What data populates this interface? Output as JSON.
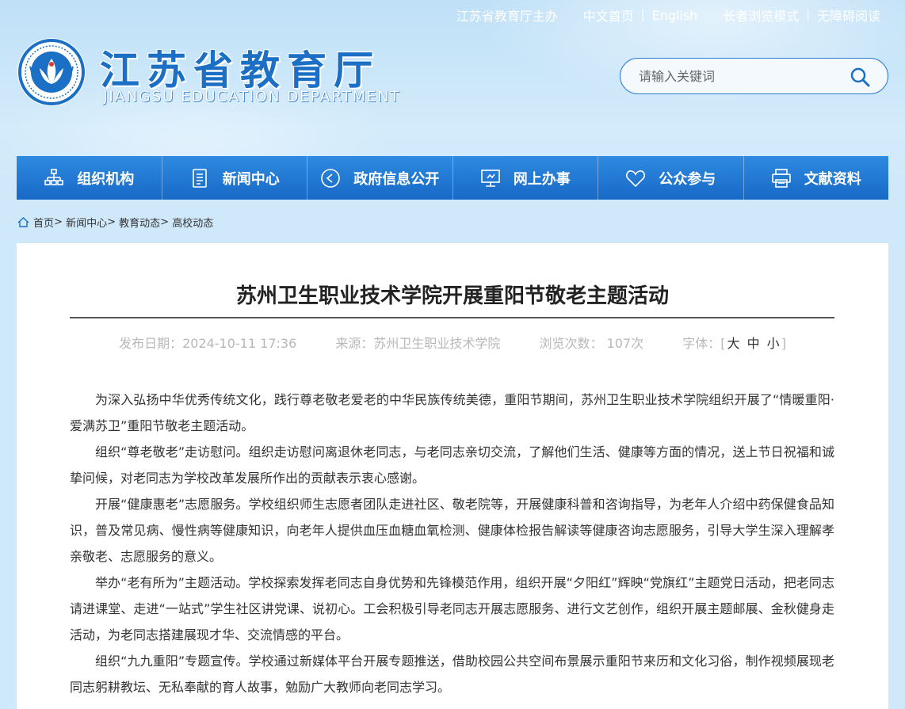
{
  "toplinks": {
    "sponsor": "江苏省教育厅主办",
    "home_cn": "中文首页",
    "english": "English",
    "elder_mode": "长者浏览模式",
    "accessible": "无障碍阅读"
  },
  "header": {
    "title": "江苏省教育厅",
    "subtitle": "JIANGSU EDUCATION DEPARTMENT"
  },
  "search": {
    "placeholder": "请输入关键词"
  },
  "nav": [
    {
      "label": "组织机构",
      "icon": "org-chart-icon"
    },
    {
      "label": "新闻中心",
      "icon": "document-icon"
    },
    {
      "label": "政府信息公开",
      "icon": "play-circle-icon"
    },
    {
      "label": "网上办事",
      "icon": "monitor-icon"
    },
    {
      "label": "公众参与",
      "icon": "heart-icon"
    },
    {
      "label": "文献资料",
      "icon": "printer-icon"
    }
  ],
  "breadcrumb": {
    "home": "首页",
    "sep": ">",
    "l1": "新闻中心",
    "l2": "教育动态",
    "l3": "高校动态"
  },
  "article": {
    "title": "苏州卫生职业技术学院开展重阳节敬老主题活动",
    "date": "发布日期：2024-10-11 17:36",
    "source": "来源：苏州卫生职业技术学院",
    "views": "浏览次数： 107次",
    "font_label": "字体：",
    "font_big": "大",
    "font_mid": "中",
    "font_small": "小",
    "paragraphs": [
      "为深入弘扬中华优秀传统文化，践行尊老敬老爱老的中华民族传统美德，重阳节期间，苏州卫生职业技术学院组织开展了“情暖重阳·爱满苏卫”重阳节敬老主题活动。",
      "组织“尊老敬老”走访慰问。组织走访慰问离退休老同志，与老同志亲切交流，了解他们生活、健康等方面的情况，送上节日祝福和诚挚问候，对老同志为学校改革发展所作出的贡献表示衷心感谢。",
      "开展“健康惠老”志愿服务。学校组织师生志愿者团队走进社区、敬老院等，开展健康科普和咨询指导，为老年人介绍中药保健食品知识，普及常见病、慢性病等健康知识，向老年人提供血压血糖血氧检测、健康体检报告解读等健康咨询志愿服务，引导大学生深入理解孝亲敬老、志愿服务的意义。",
      "举办“老有所为”主题活动。学校探索发挥老同志自身优势和先锋模范作用，组织开展“夕阳红”辉映“党旗红”主题党日活动，把老同志请进课堂、走进“一站式”学生社区讲党课、说初心。工会积极引导老同志开展志愿服务、进行文艺创作，组织开展主题邮展、金秋健身走活动，为老同志搭建展现才华、交流情感的平台。",
      "组织“九九重阳”专题宣传。学校通过新媒体平台开展专题推送，借助校园公共空间布景展示重阳节来历和文化习俗，制作视频展现老同志躬耕教坛、无私奉献的育人故事，勉励广大教师向老同志学习。"
    ]
  },
  "colors": {
    "nav_bg": "#1f77d2",
    "title_blue": "#1b6fc4",
    "page_bg": "#cfe8fa"
  }
}
